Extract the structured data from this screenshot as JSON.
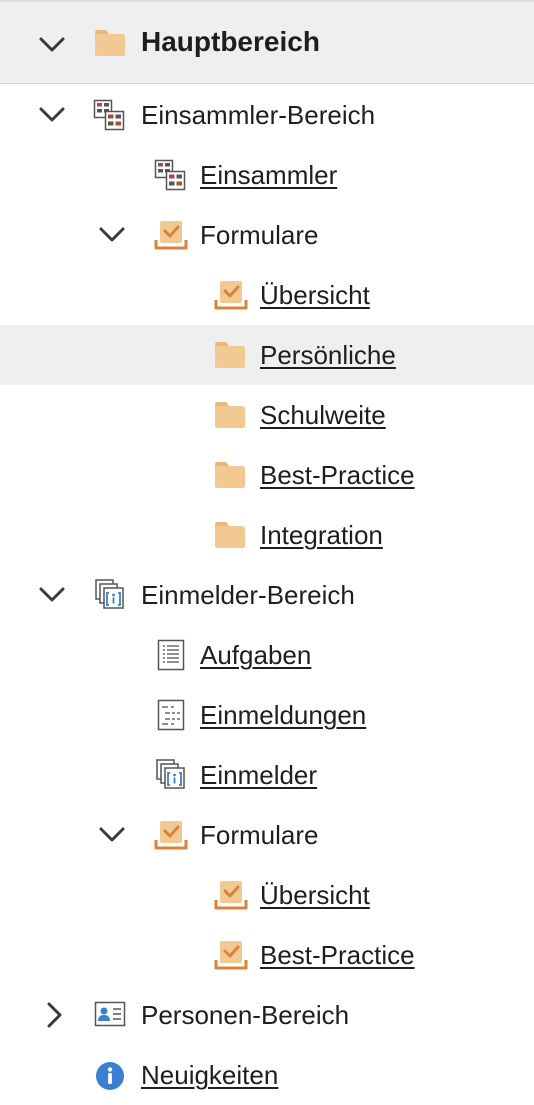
{
  "header": {
    "title": "Hauptbereich"
  },
  "tree": {
    "einsammler_bereich": {
      "label": "Einsammler-Bereich",
      "einsammler": "Einsammler",
      "formulare": {
        "label": "Formulare",
        "uebersicht": "Übersicht",
        "persoenliche": "Persönliche",
        "schulweite": "Schulweite",
        "best_practice": "Best-Practice",
        "integration": "Integration"
      }
    },
    "einmelder_bereich": {
      "label": "Einmelder-Bereich",
      "aufgaben": "Aufgaben",
      "einmeldungen": "Einmeldungen",
      "einmelder": "Einmelder",
      "formulare": {
        "label": "Formulare",
        "uebersicht": "Übersicht",
        "best_practice": "Best-Practice"
      }
    },
    "personen_bereich": {
      "label": "Personen-Bereich"
    },
    "neuigkeiten": {
      "label": "Neuigkeiten"
    }
  },
  "colors": {
    "folder": "#f2c992",
    "folder_tab": "#e9b77a",
    "form_orange": "#d7843a",
    "selection_bg": "#efefef",
    "info_blue": "#3b7fd3",
    "collector_red": "#b3473b"
  }
}
